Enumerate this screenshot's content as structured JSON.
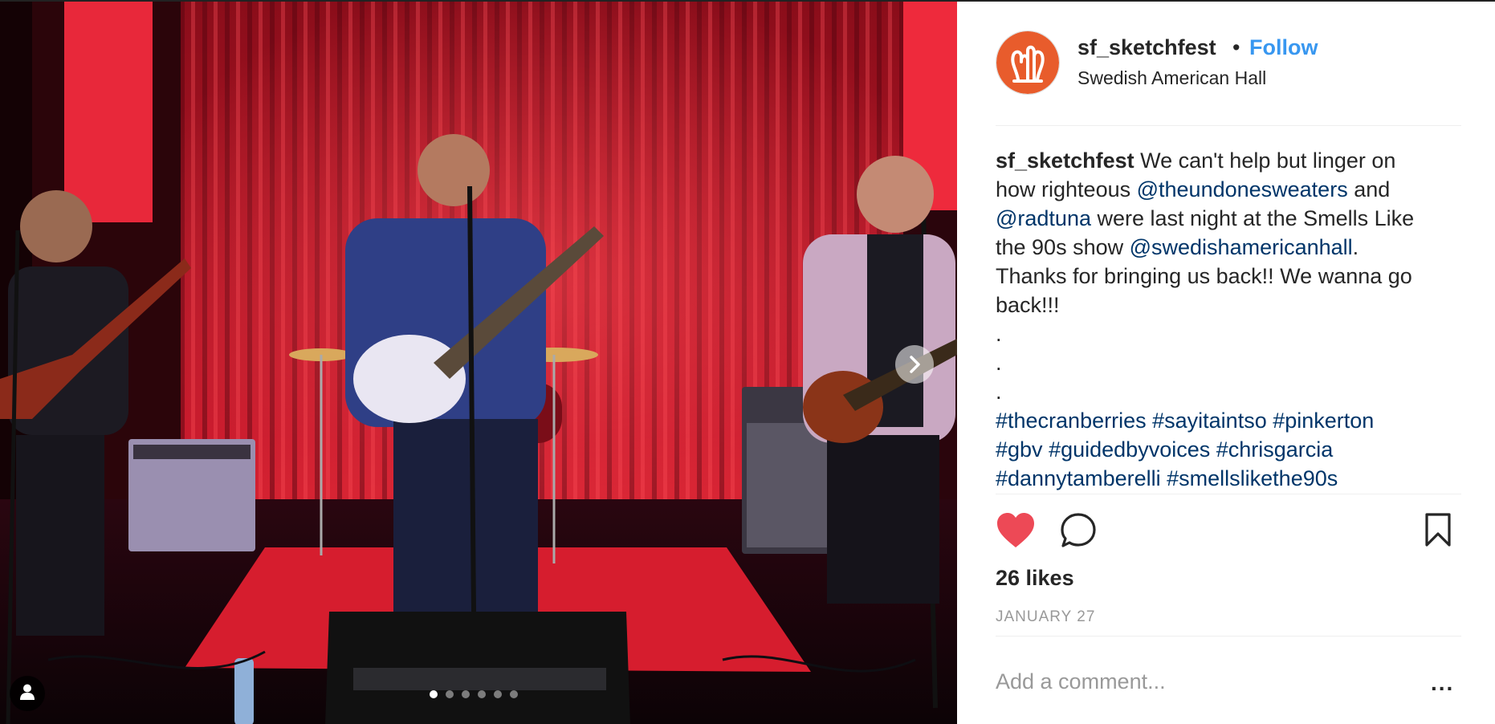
{
  "post": {
    "username": "sf_sketchfest",
    "bullet": "•",
    "follow_label": "Follow",
    "location": "Swedish American Hall",
    "caption": {
      "line1": {
        "user": "sf_sketchfest",
        "text": " We can't help but linger on"
      },
      "line2": {
        "text1": "how righteous ",
        "mention": "@theundonesweaters",
        "text2": " and"
      },
      "line3": {
        "mention": "@radtuna",
        "text": " were last night at the Smells Like"
      },
      "line4": {
        "text1": "the 90s show ",
        "mention": "@swedishamericanhall",
        "text2": "."
      },
      "line5": "Thanks for bringing us back!! We wanna go",
      "line6": "back!!!",
      "dot1": ".",
      "dot2": ".",
      "dot3": ".",
      "hashtags": {
        "row1": [
          "#thecranberries",
          "#sayitaintso",
          "#pinkerton"
        ],
        "row2": [
          "#gbv",
          "#guidedbyvoices",
          "#chrisgarcia"
        ],
        "row3": [
          "#dannytamberelli",
          "#smellslikethe90s"
        ]
      }
    },
    "likes": "26 likes",
    "date": "JANUARY 27",
    "comment_placeholder": "Add a comment...",
    "more_label": "...",
    "carousel": {
      "slide_count": 6,
      "active_index": 0
    }
  },
  "icons": {
    "heart": "heart-icon",
    "comment": "comment-icon",
    "bookmark": "bookmark-icon",
    "next": "chevron-right-icon",
    "tag": "user-tag-icon",
    "avatar_logo": "hands-logo"
  },
  "colors": {
    "follow": "#3897f0",
    "link": "#003569",
    "liked_heart": "#ed4956",
    "avatar_bg": "#e85c2c",
    "muted": "#999999",
    "text": "#262626"
  }
}
